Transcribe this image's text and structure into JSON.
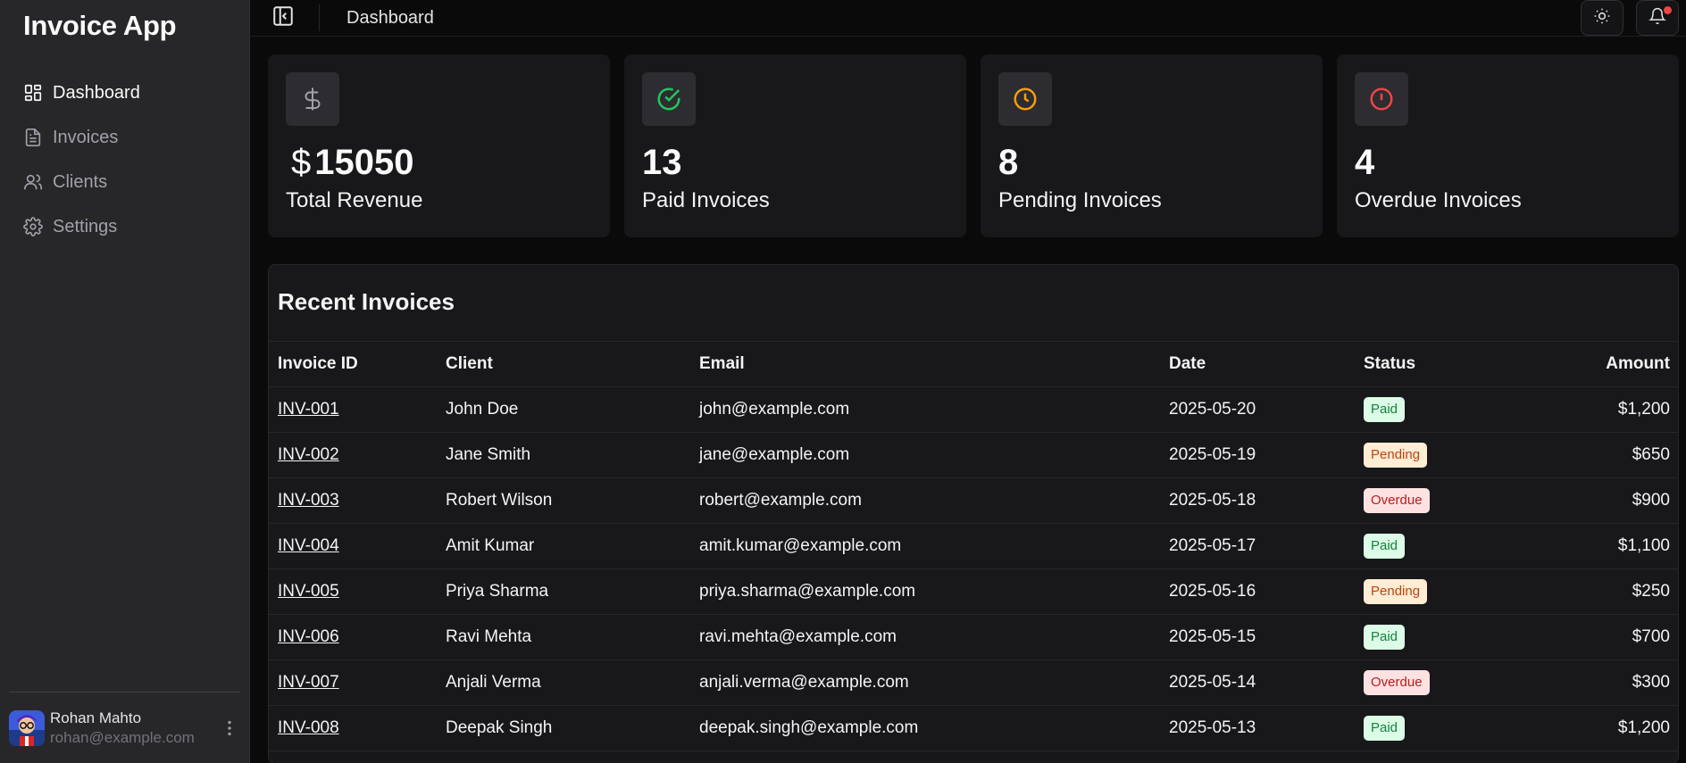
{
  "app": {
    "title": "Invoice App"
  },
  "sidebar": {
    "items": [
      {
        "label": "Dashboard",
        "icon": "dashboard-icon",
        "active": true
      },
      {
        "label": "Invoices",
        "icon": "file-text-icon",
        "active": false
      },
      {
        "label": "Clients",
        "icon": "users-icon",
        "active": false
      },
      {
        "label": "Settings",
        "icon": "gear-icon",
        "active": false
      }
    ],
    "user": {
      "name": "Rohan Mahto",
      "email": "rohan@example.com"
    }
  },
  "header": {
    "title": "Dashboard"
  },
  "stats": [
    {
      "icon": "dollar-icon",
      "currency": "$",
      "value": "15050",
      "label": "Total Revenue",
      "color": "#a1a1aa"
    },
    {
      "icon": "check-circle-icon",
      "value": "13",
      "label": "Paid Invoices",
      "color": "#22c55e"
    },
    {
      "icon": "clock-icon",
      "value": "8",
      "label": "Pending Invoices",
      "color": "#f59e0b"
    },
    {
      "icon": "alert-circle-icon",
      "value": "4",
      "label": "Overdue Invoices",
      "color": "#ef4444"
    }
  ],
  "invoices": {
    "title": "Recent Invoices",
    "columns": [
      "Invoice ID",
      "Client",
      "Email",
      "Date",
      "Status",
      "Amount"
    ],
    "rows": [
      {
        "id": "INV-001",
        "client": "John Doe",
        "email": "john@example.com",
        "date": "2025-05-20",
        "status": "Paid",
        "amount": "$1,200"
      },
      {
        "id": "INV-002",
        "client": "Jane Smith",
        "email": "jane@example.com",
        "date": "2025-05-19",
        "status": "Pending",
        "amount": "$650"
      },
      {
        "id": "INV-003",
        "client": "Robert Wilson",
        "email": "robert@example.com",
        "date": "2025-05-18",
        "status": "Overdue",
        "amount": "$900"
      },
      {
        "id": "INV-004",
        "client": "Amit Kumar",
        "email": "amit.kumar@example.com",
        "date": "2025-05-17",
        "status": "Paid",
        "amount": "$1,100"
      },
      {
        "id": "INV-005",
        "client": "Priya Sharma",
        "email": "priya.sharma@example.com",
        "date": "2025-05-16",
        "status": "Pending",
        "amount": "$250"
      },
      {
        "id": "INV-006",
        "client": "Ravi Mehta",
        "email": "ravi.mehta@example.com",
        "date": "2025-05-15",
        "status": "Paid",
        "amount": "$700"
      },
      {
        "id": "INV-007",
        "client": "Anjali Verma",
        "email": "anjali.verma@example.com",
        "date": "2025-05-14",
        "status": "Overdue",
        "amount": "$300"
      },
      {
        "id": "INV-008",
        "client": "Deepak Singh",
        "email": "deepak.singh@example.com",
        "date": "2025-05-13",
        "status": "Paid",
        "amount": "$1,200"
      }
    ]
  }
}
